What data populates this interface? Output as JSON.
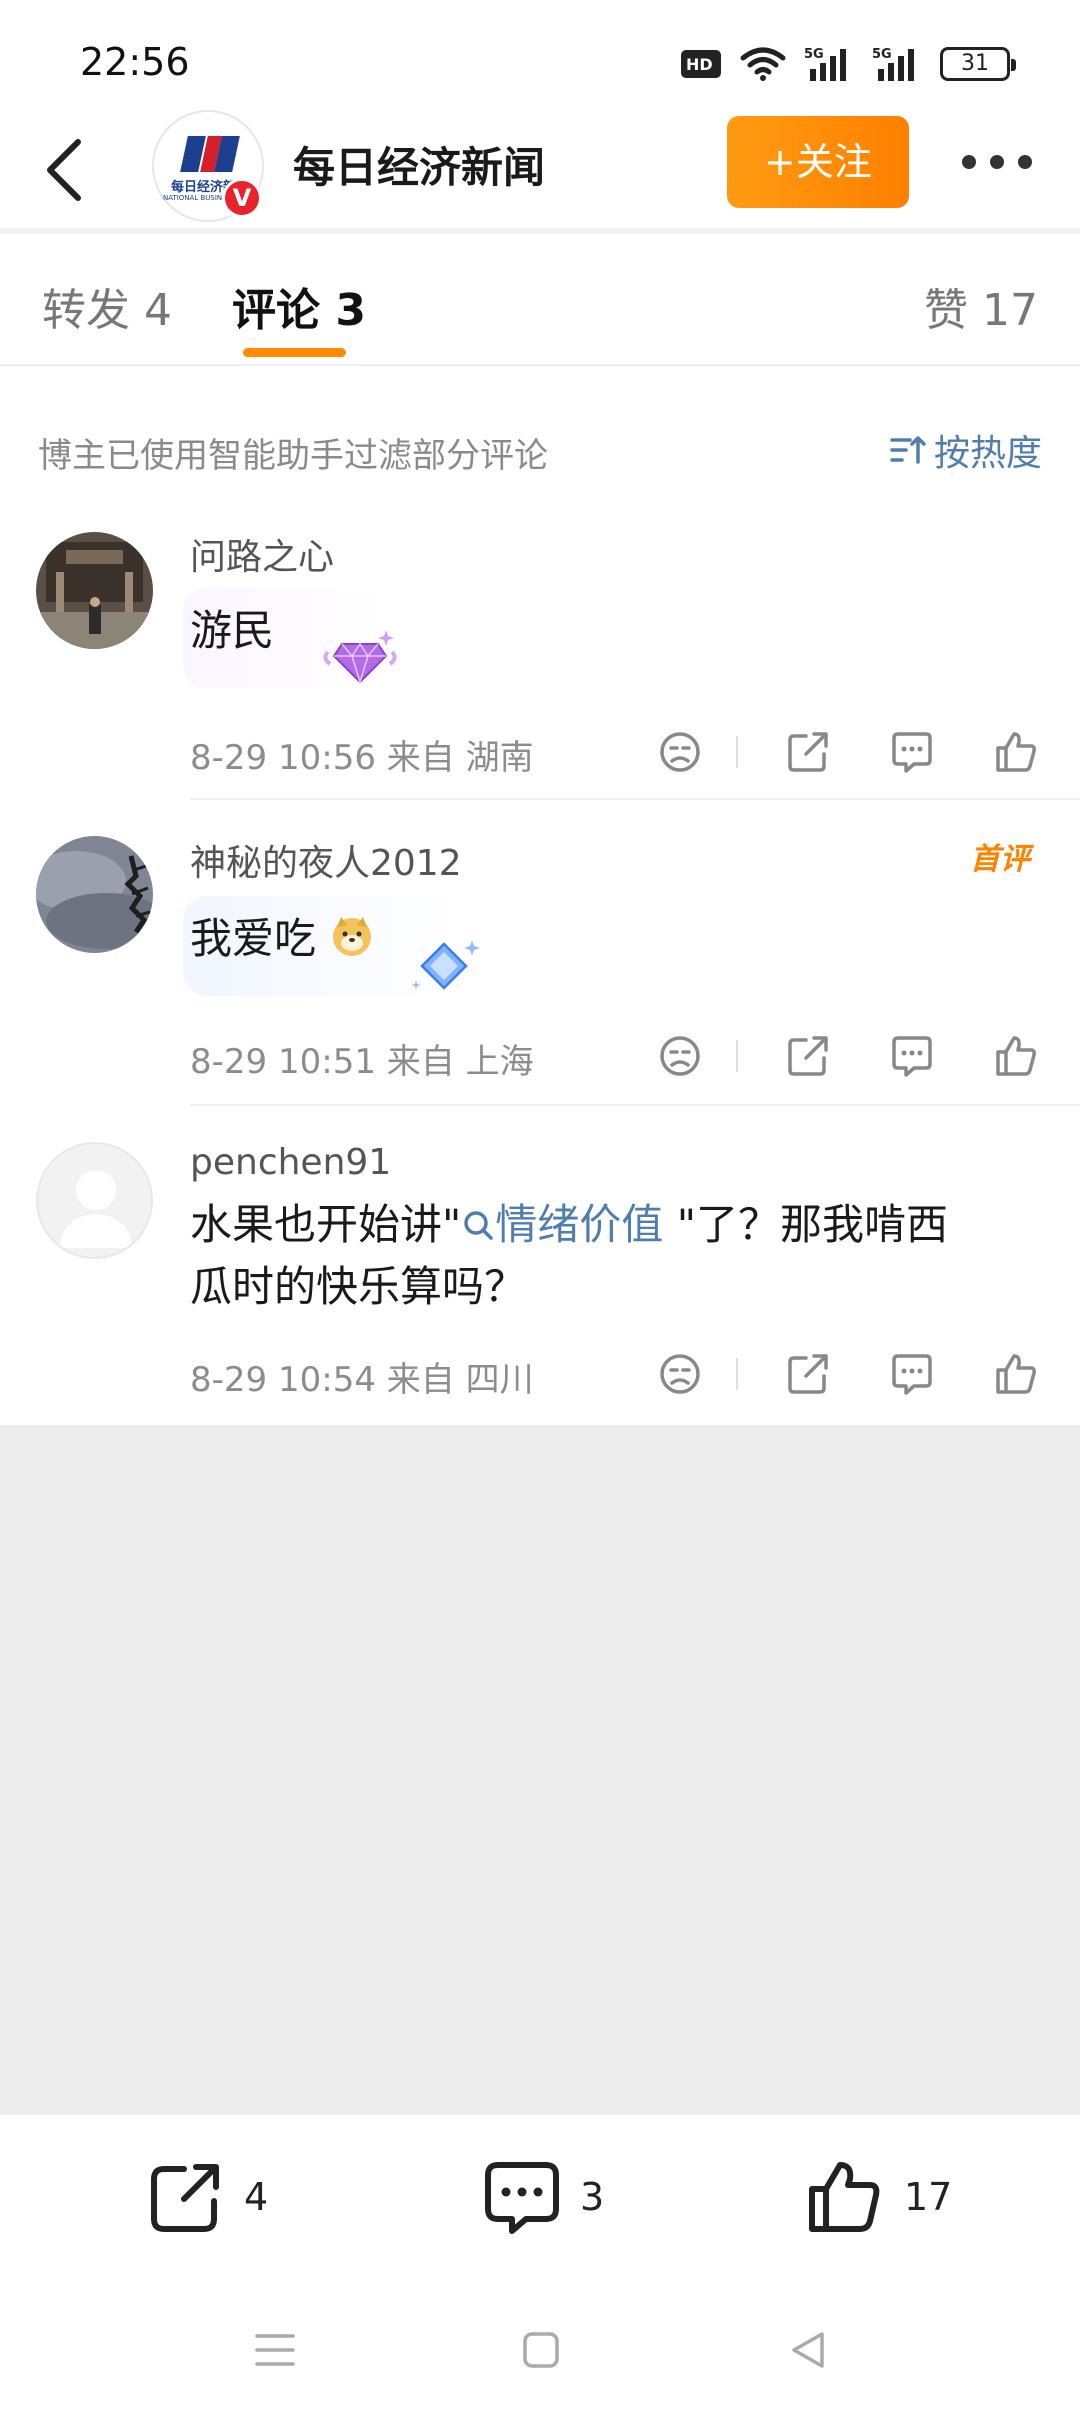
{
  "status_bar": {
    "time": "22:56",
    "battery": "31",
    "icons": [
      "hd-voice-icon",
      "wifi-icon",
      "5g-signal-icon",
      "5g-signal-icon",
      "battery-icon"
    ]
  },
  "header": {
    "account_name": "每日经济新闻",
    "follow_label": "+关注",
    "logo_text": "每日经济新闻",
    "logo_sub": "NATIONAL BUSINESS DAILY",
    "verified_badge": "V"
  },
  "tabs": {
    "repost": "转发 4",
    "comments": "评论 3",
    "likes": "赞 17"
  },
  "filter": {
    "note": "博主已使用智能助手过滤部分评论",
    "sort_label": "按热度"
  },
  "comments": [
    {
      "user": "问路之心",
      "text": "游民",
      "meta": "8-29 10:56  来自 湖南"
    },
    {
      "user": "神秘的夜人2012",
      "text": "我爱吃",
      "meta": "8-29 10:51  来自 上海",
      "badge": "首评"
    },
    {
      "user": "penchen91",
      "text_before": "水果也开始讲\"",
      "topic": "情绪价值",
      "text_after": " \"了？那我啃西",
      "text_line2": "瓜时的快乐算吗？",
      "meta": "8-29 10:54  来自 四川"
    }
  ],
  "bottom_bar": {
    "repost_count": "4",
    "comment_count": "3",
    "like_count": "17"
  },
  "colors": {
    "accent_orange": "#ff8c00",
    "link_blue": "#507daf",
    "verified_red": "#e8232b"
  }
}
